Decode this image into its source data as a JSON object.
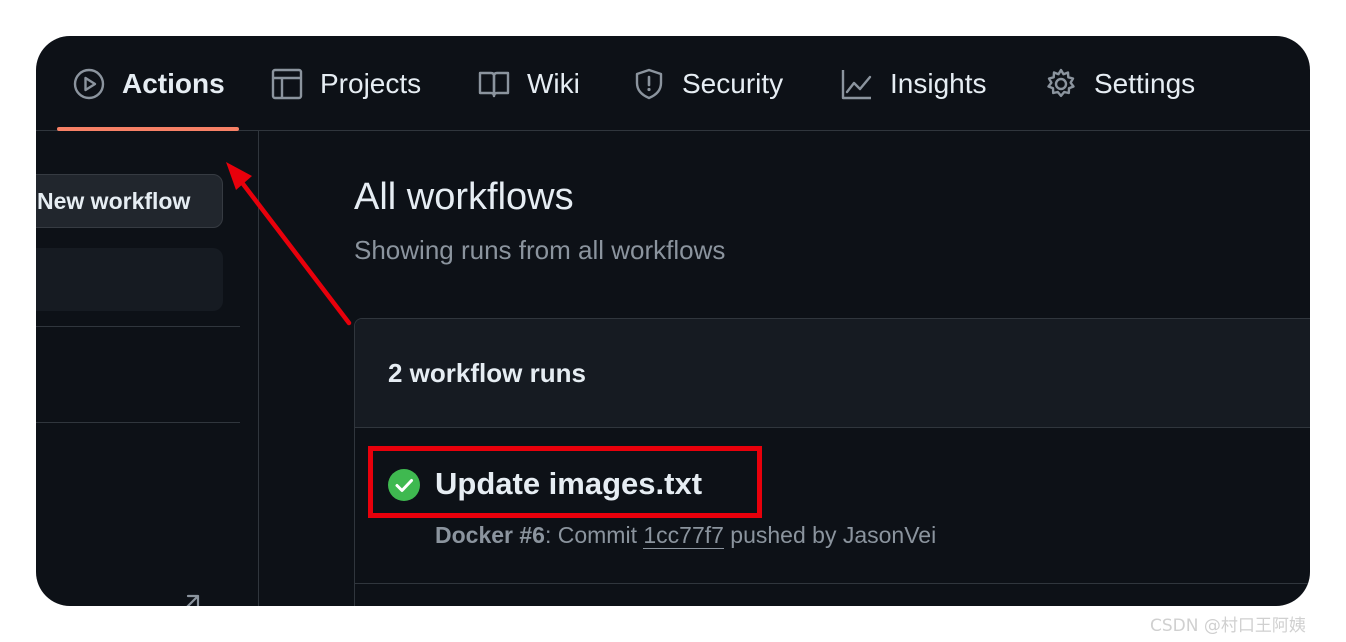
{
  "nav": {
    "tabs": [
      {
        "label": "Actions",
        "icon": "play-icon",
        "active": true
      },
      {
        "label": "Projects",
        "icon": "table-icon"
      },
      {
        "label": "Wiki",
        "icon": "book-icon"
      },
      {
        "label": "Security",
        "icon": "shield-icon"
      },
      {
        "label": "Insights",
        "icon": "graph-icon"
      },
      {
        "label": "Settings",
        "icon": "gear-icon"
      }
    ]
  },
  "sidebar": {
    "new_workflow_label": "New workflow"
  },
  "main": {
    "title": "All workflows",
    "subtitle": "Showing runs from all workflows"
  },
  "runs": {
    "count_label": "2 workflow runs",
    "items": [
      {
        "title": "Update images.txt",
        "status": "success",
        "workflow": "Docker",
        "run_number": "#6",
        "meta_prefix": ": Commit ",
        "commit": "1cc77f7",
        "meta_suffix": " pushed by JasonVei"
      }
    ]
  },
  "annotation": {
    "highlight_color": "#e8000b",
    "arrow_color": "#e8000b"
  },
  "watermark": "CSDN @村口王阿姨",
  "colors": {
    "background": "#0d1117",
    "active_tab_underline": "#f78166",
    "success": "#3fb950"
  }
}
